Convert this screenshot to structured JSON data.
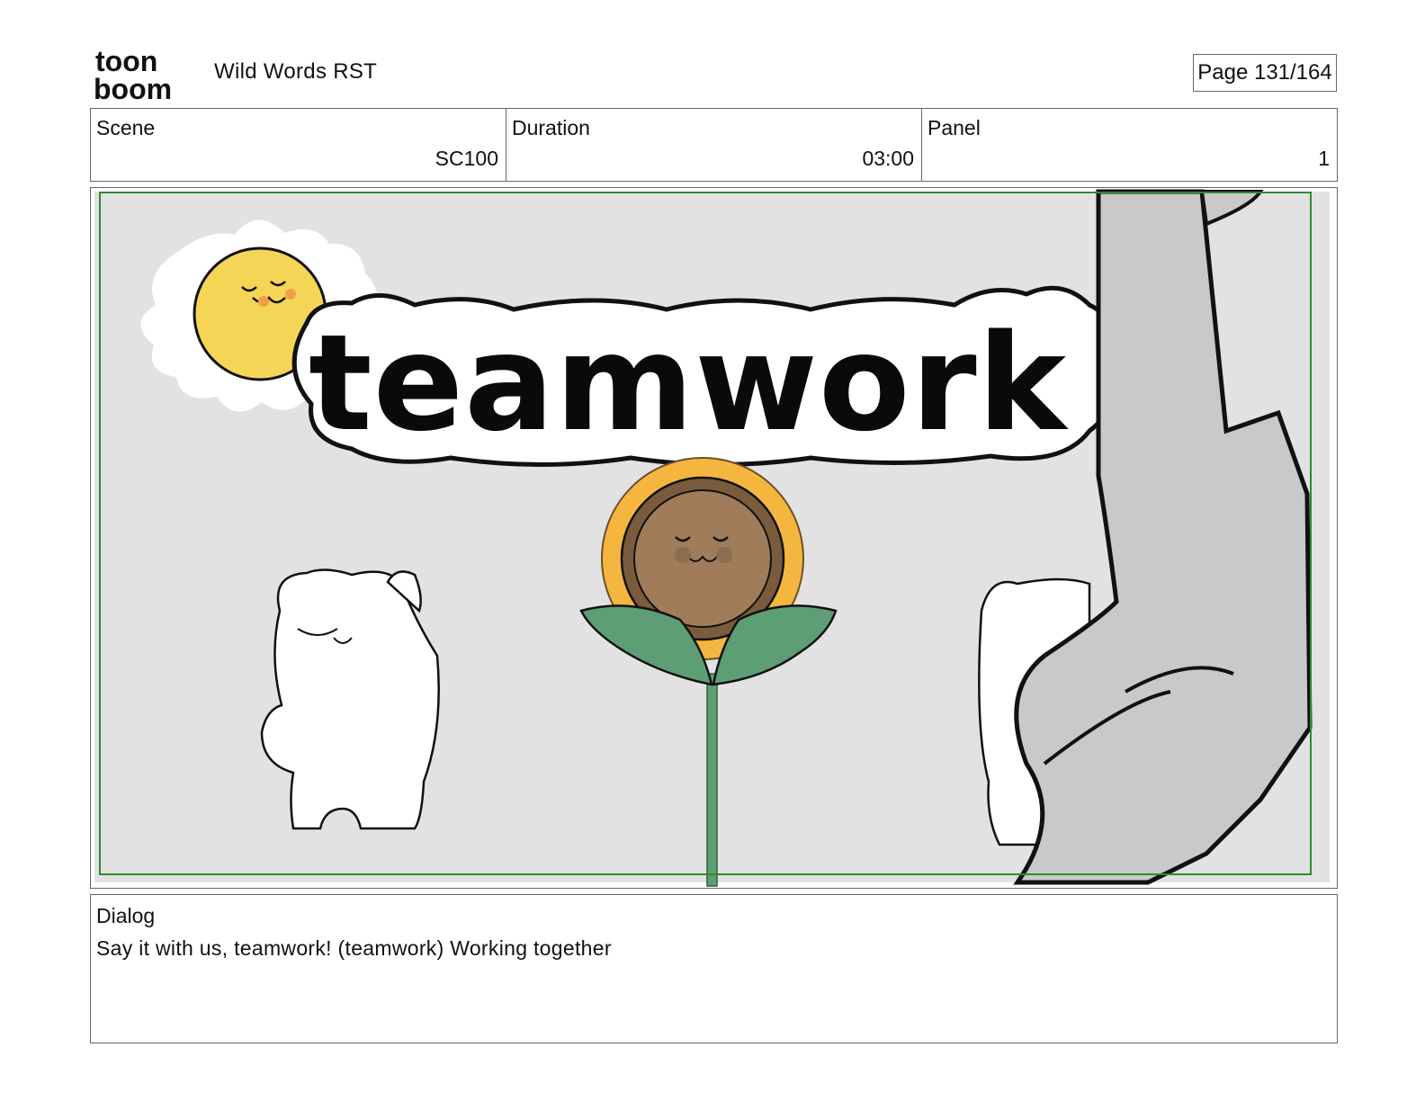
{
  "header": {
    "logo_top": "toon",
    "logo_bottom": "boom",
    "project_title": "Wild Words RST",
    "page_label": "Page 131/164"
  },
  "info": {
    "scene_label": "Scene",
    "scene_value": "SC100",
    "duration_label": "Duration",
    "duration_value": "03:00",
    "panel_label": "Panel",
    "panel_value": "1"
  },
  "panel_image": {
    "banner_text": "teamwork",
    "colors": {
      "background": "#e2e2e2",
      "safe_frame": "#2e8b2e",
      "sun": "#f5d556",
      "petals": "#f4b63e",
      "flower_face": "#a07c5a",
      "leaves": "#5e9e74",
      "tube": "#c9c9c9"
    }
  },
  "dialog": {
    "label": "Dialog",
    "text": "Say it with us, teamwork! (teamwork) Working together"
  }
}
